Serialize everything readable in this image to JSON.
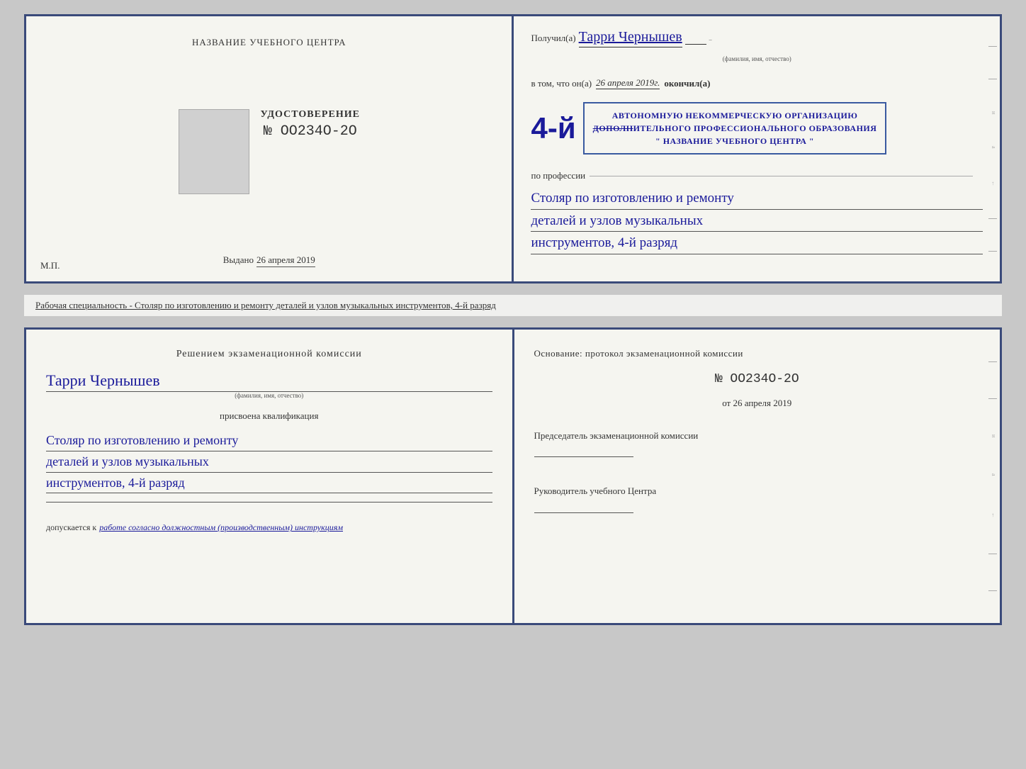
{
  "top_doc": {
    "left": {
      "institution_title": "НАЗВАНИЕ УЧЕБНОГО ЦЕНТРА",
      "udostoverenie_label": "УДОСТОВЕРЕНИЕ",
      "udostoverenie_number": "№ OO234O-2O",
      "issued_label": "Выдано",
      "issued_date": "26 апреля 2019",
      "mp_label": "М.П."
    },
    "right": {
      "poluchil_prefix": "Получил(а)",
      "recipient_name": "Тарри Чернышев",
      "fio_label": "(фамилия, имя, отчество)",
      "vtom_prefix": "в том, что он(а)",
      "vtom_date": "26 апреля 2019г.",
      "okoncil": "окончил(а)",
      "big_number": "4-й",
      "stamp_line1": "АВТОНОМНУЮ НЕКОММЕРЧЕСКУЮ ОРГАНИЗАЦИЮ",
      "stamp_line2": "ДОПОЛНИТЕЛЬНОГО ПРОФЕССИОНАЛЬНОГО ОБРАЗОВАНИЯ",
      "stamp_line3": "\" НАЗВАНИЕ УЧЕБНОГО ЦЕНТРА \"",
      "po_professii": "по профессии",
      "profession_line1": "Столяр по изготовлению и ремонту",
      "profession_line2": "деталей и узлов музыкальных",
      "profession_line3": "инструментов, 4-й разряд"
    }
  },
  "subtitle": {
    "text": "Рабочая специальность - Столяр по изготовлению и ремонту деталей и узлов музыкальных инструментов, 4-й разряд"
  },
  "bottom_doc": {
    "left": {
      "resheniem": "Решением экзаменационной комиссии",
      "name": "Тарри Чернышев",
      "fio_label": "(фамилия, имя, отчество)",
      "prisvoena": "присвоена квалификация",
      "kval_line1": "Столяр по изготовлению и ремонту",
      "kval_line2": "деталей и узлов музыкальных",
      "kval_line3": "инструментов, 4-й разряд",
      "dopusk_label": "допускается к",
      "dopusk_text": "работе согласно должностным (производственным) инструкциям"
    },
    "right": {
      "osnovanie": "Основание: протокол экзаменационной комиссии",
      "protocol_number": "№ OO234O-2O",
      "ot_label": "от",
      "ot_date": "26 апреля 2019",
      "predsedatel_label": "Председатель экзаменационной комиссии",
      "rukovoditel_label": "Руководитель учебного Центра"
    }
  }
}
